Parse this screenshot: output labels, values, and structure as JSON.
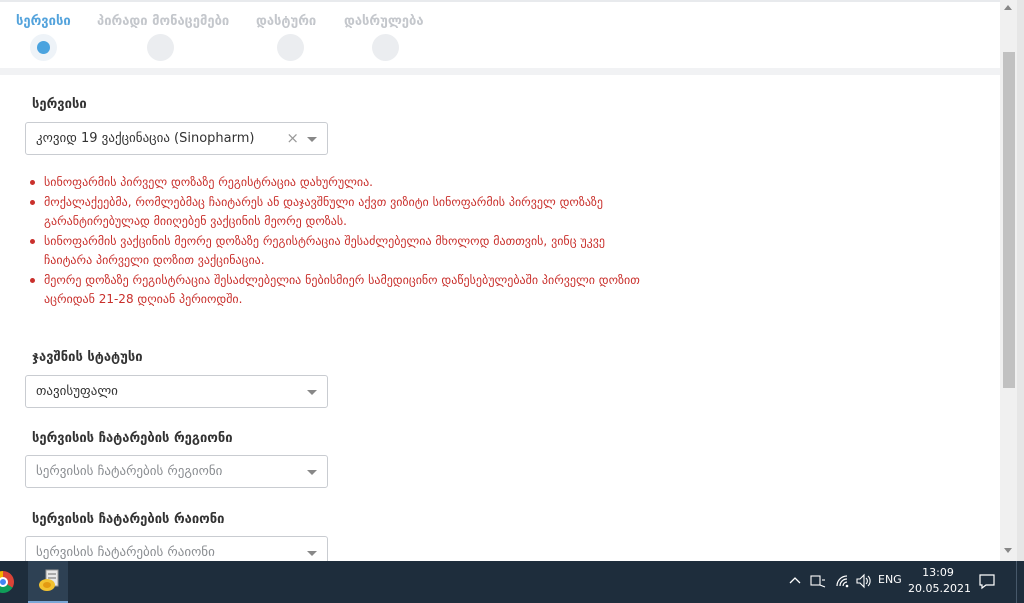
{
  "stepper": {
    "steps": [
      {
        "label": "სერვისი",
        "active": true
      },
      {
        "label": "პირადი მონაცემები",
        "active": false
      },
      {
        "label": "დასტური",
        "active": false
      },
      {
        "label": "დასრულება",
        "active": false
      }
    ]
  },
  "form": {
    "service": {
      "label": "სერვისი",
      "value": "კოვიდ 19 ვაქცინაცია (Sinopharm)",
      "clear_icon": "×"
    },
    "notices": [
      "სინოფარმის პირველ დოზაზე რეგისტრაცია დახურულია.",
      "მოქალაქეებმა, რომლებმაც ჩაიტარეს ან დაჯავშნული აქვთ ვიზიტი სინოფარმის პირველ დოზაზე გარანტირებულად მიიღებენ ვაქცინის მეორე დოზას.",
      "სინოფარმის ვაქცინის მეორე დოზაზე რეგისტრაცია შესაძლებელია მხოლოდ მათთვის, ვინც უკვე ჩაიტარა პირველი დოზით ვაქცინაცია.",
      "მეორე დოზაზე რეგისტრაცია შესაძლებელია ნებისმიერ სამედიცინო დაწესებულებაში პირველი დოზით აცრიდან 21-28 დღიან პერიოდში."
    ],
    "booking_status": {
      "label": "ჯავშნის სტატუსი",
      "value": "თავისუფალი"
    },
    "region": {
      "label": "სერვისის ჩატარების რეგიონი",
      "placeholder": "სერვისის ჩატარების რეგიონი"
    },
    "district": {
      "label": "სერვისის ჩატარების რაიონი",
      "placeholder": "სერვისის ჩატარების რაიონი"
    }
  },
  "taskbar": {
    "language": "ENG",
    "time": "13:09",
    "date": "20.05.2021"
  },
  "colors": {
    "accent": "#54a3dc",
    "error": "#c9302c",
    "taskbar": "#1e2d3c"
  }
}
